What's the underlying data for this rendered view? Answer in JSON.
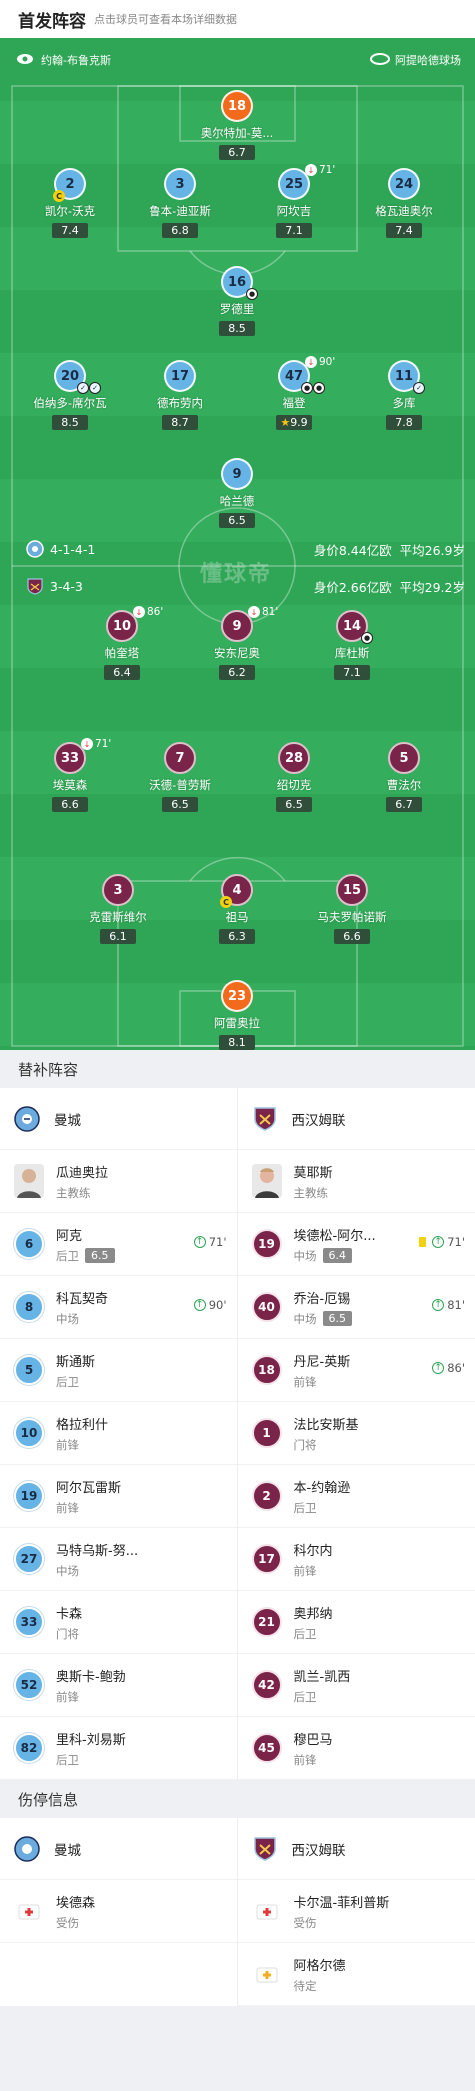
{
  "header": {
    "title": "首发阵容",
    "subtitle": "点击球员可查看本场详细数据"
  },
  "venue": {
    "referee": "约翰-布鲁克斯",
    "stadium": "阿提哈德球场"
  },
  "home": {
    "formation": "4-1-4-1",
    "value": "身价8.44亿欧",
    "age": "平均26.9岁"
  },
  "away": {
    "formation": "3-4-3",
    "value": "身价2.66亿欧",
    "age": "平均29.2岁"
  },
  "watermark": "懂球帝",
  "pitch_players": [
    {
      "num": "18",
      "name": "奥尔特加-莫...",
      "rating": "6.7",
      "team": "gk1"
    },
    {
      "num": "2",
      "name": "凯尔-沃克",
      "rating": "7.4",
      "team": "mc",
      "captain": true
    },
    {
      "num": "3",
      "name": "鲁本-迪亚斯",
      "rating": "6.8",
      "team": "mc"
    },
    {
      "num": "25",
      "name": "阿坎吉",
      "rating": "7.1",
      "team": "mc",
      "sub": "71'"
    },
    {
      "num": "24",
      "name": "格瓦迪奥尔",
      "rating": "7.4",
      "team": "mc"
    },
    {
      "num": "16",
      "name": "罗德里",
      "rating": "8.5",
      "team": "mc",
      "goal": true
    },
    {
      "num": "20",
      "name": "伯纳多-席尔瓦",
      "rating": "8.5",
      "team": "mc",
      "assists": 2
    },
    {
      "num": "17",
      "name": "德布劳内",
      "rating": "8.7",
      "team": "mc"
    },
    {
      "num": "47",
      "name": "福登",
      "rating": "9.9",
      "team": "mc",
      "sub": "90'",
      "goals": 2,
      "star": true
    },
    {
      "num": "11",
      "name": "多库",
      "rating": "7.8",
      "team": "mc",
      "assist": true
    },
    {
      "num": "9",
      "name": "哈兰德",
      "rating": "6.5",
      "team": "mc"
    },
    {
      "num": "10",
      "name": "帕奎塔",
      "rating": "6.4",
      "team": "wh",
      "sub": "86'"
    },
    {
      "num": "9",
      "name": "安东尼奥",
      "rating": "6.2",
      "team": "wh",
      "sub": "81'"
    },
    {
      "num": "14",
      "name": "库杜斯",
      "rating": "7.1",
      "team": "wh",
      "goal": true
    },
    {
      "num": "33",
      "name": "埃莫森",
      "rating": "6.6",
      "team": "wh",
      "sub": "71'"
    },
    {
      "num": "7",
      "name": "沃德-普劳斯",
      "rating": "6.5",
      "team": "wh"
    },
    {
      "num": "28",
      "name": "绍切克",
      "rating": "6.5",
      "team": "wh"
    },
    {
      "num": "5",
      "name": "曹法尔",
      "rating": "6.7",
      "team": "wh"
    },
    {
      "num": "3",
      "name": "克雷斯维尔",
      "rating": "6.1",
      "team": "wh"
    },
    {
      "num": "4",
      "name": "祖马",
      "rating": "6.3",
      "team": "wh",
      "captain": true
    },
    {
      "num": "15",
      "name": "马夫罗帕诺斯",
      "rating": "6.6",
      "team": "wh"
    },
    {
      "num": "23",
      "name": "阿雷奥拉",
      "rating": "8.1",
      "team": "gk2"
    }
  ],
  "subs_section": "替补阵容",
  "subs": {
    "home_team": "曼城",
    "away_team": "西汉姆联",
    "home_coach": {
      "name": "瓜迪奥拉",
      "role": "主教练"
    },
    "away_coach": {
      "name": "莫耶斯",
      "role": "主教练"
    },
    "home": [
      {
        "num": "6",
        "name": "阿克",
        "pos": "后卫",
        "rating": "6.5",
        "in": "71'"
      },
      {
        "num": "8",
        "name": "科瓦契奇",
        "pos": "中场",
        "in": "90'"
      },
      {
        "num": "5",
        "name": "斯通斯",
        "pos": "后卫"
      },
      {
        "num": "10",
        "name": "格拉利什",
        "pos": "前锋"
      },
      {
        "num": "19",
        "name": "阿尔瓦雷斯",
        "pos": "前锋"
      },
      {
        "num": "27",
        "name": "马特乌斯-努...",
        "pos": "中场"
      },
      {
        "num": "33",
        "name": "卡森",
        "pos": "门将"
      },
      {
        "num": "52",
        "name": "奥斯卡-鲍勃",
        "pos": "前锋"
      },
      {
        "num": "82",
        "name": "里科-刘易斯",
        "pos": "后卫"
      }
    ],
    "away": [
      {
        "num": "19",
        "name": "埃德松-阿尔...",
        "pos": "中场",
        "rating": "6.4",
        "in": "71'",
        "yellow": true
      },
      {
        "num": "40",
        "name": "乔治-厄锡",
        "pos": "中场",
        "rating": "6.5",
        "in": "81'"
      },
      {
        "num": "18",
        "name": "丹尼-英斯",
        "pos": "前锋",
        "in": "86'"
      },
      {
        "num": "1",
        "name": "法比安斯基",
        "pos": "门将"
      },
      {
        "num": "2",
        "name": "本-约翰逊",
        "pos": "后卫"
      },
      {
        "num": "17",
        "name": "科尔内",
        "pos": "前锋"
      },
      {
        "num": "21",
        "name": "奥邦纳",
        "pos": "后卫"
      },
      {
        "num": "42",
        "name": "凯兰-凯西",
        "pos": "后卫"
      },
      {
        "num": "45",
        "name": "穆巴马",
        "pos": "前锋"
      }
    ]
  },
  "injury_section": "伤停信息",
  "injuries": {
    "home": [
      {
        "name": "埃德森",
        "status": "受伤"
      }
    ],
    "away": [
      {
        "name": "卡尔温-菲利普斯",
        "status": "受伤"
      },
      {
        "name": "阿格尔德",
        "status": "待定"
      }
    ]
  }
}
